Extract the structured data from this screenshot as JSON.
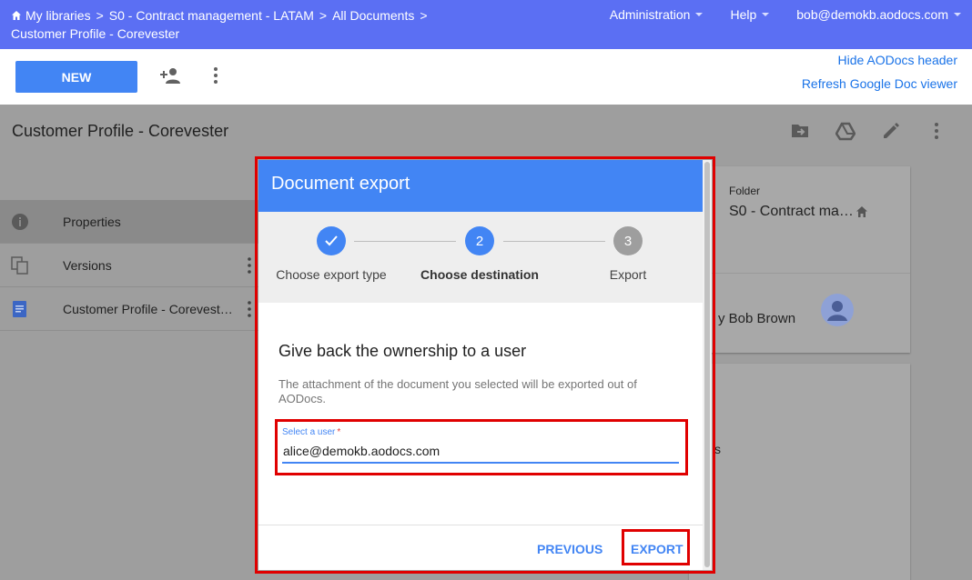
{
  "header": {
    "breadcrumbs": [
      "My libraries",
      "S0 - Contract management - LATAM",
      "All Documents",
      "Customer Profile - Corevester"
    ],
    "separator": ">",
    "nav": [
      {
        "label": "Administration"
      },
      {
        "label": "Help"
      },
      {
        "label": "bob@demokb.aodocs.com"
      }
    ],
    "bg_color": "#5b6ff3"
  },
  "actionbar": {
    "new_label": "NEW",
    "hide_header_link": "Hide AODocs header",
    "refresh_link": "Refresh Google Doc viewer",
    "icons": [
      "add-user-icon",
      "more-vert-icon"
    ]
  },
  "document": {
    "title": "Customer Profile - Corevester",
    "tools": [
      "move-to-folder-icon",
      "drive-icon",
      "edit-icon",
      "more-vert-icon"
    ],
    "sidebar": [
      {
        "label": "Properties",
        "icon": "info-icon"
      },
      {
        "label": "Versions",
        "icon": "versions-icon"
      },
      {
        "label": "Customer Profile - Corevest…",
        "icon": "doc-icon"
      }
    ],
    "folder_label": "Folder",
    "folder_value": "S0 - Contract ma…",
    "owner_text": "y Bob Brown",
    "card2_text": "s"
  },
  "modal": {
    "title": "Document export",
    "steps": [
      {
        "label": "Choose export type",
        "state": "done",
        "number": ""
      },
      {
        "label": "Choose destination",
        "state": "active",
        "number": "2"
      },
      {
        "label": "Export",
        "state": "pending",
        "number": "3"
      }
    ],
    "body_title": "Give back the ownership to a user",
    "body_desc": "The attachment of the document you selected will be exported out of AODocs.",
    "field": {
      "label": "Select a user",
      "required_mark": "*",
      "value": "alice@demokb.aodocs.com"
    },
    "previous_label": "PREVIOUS",
    "export_label": "EXPORT",
    "accent": "#4285f4",
    "highlight_color": "#e00000"
  }
}
